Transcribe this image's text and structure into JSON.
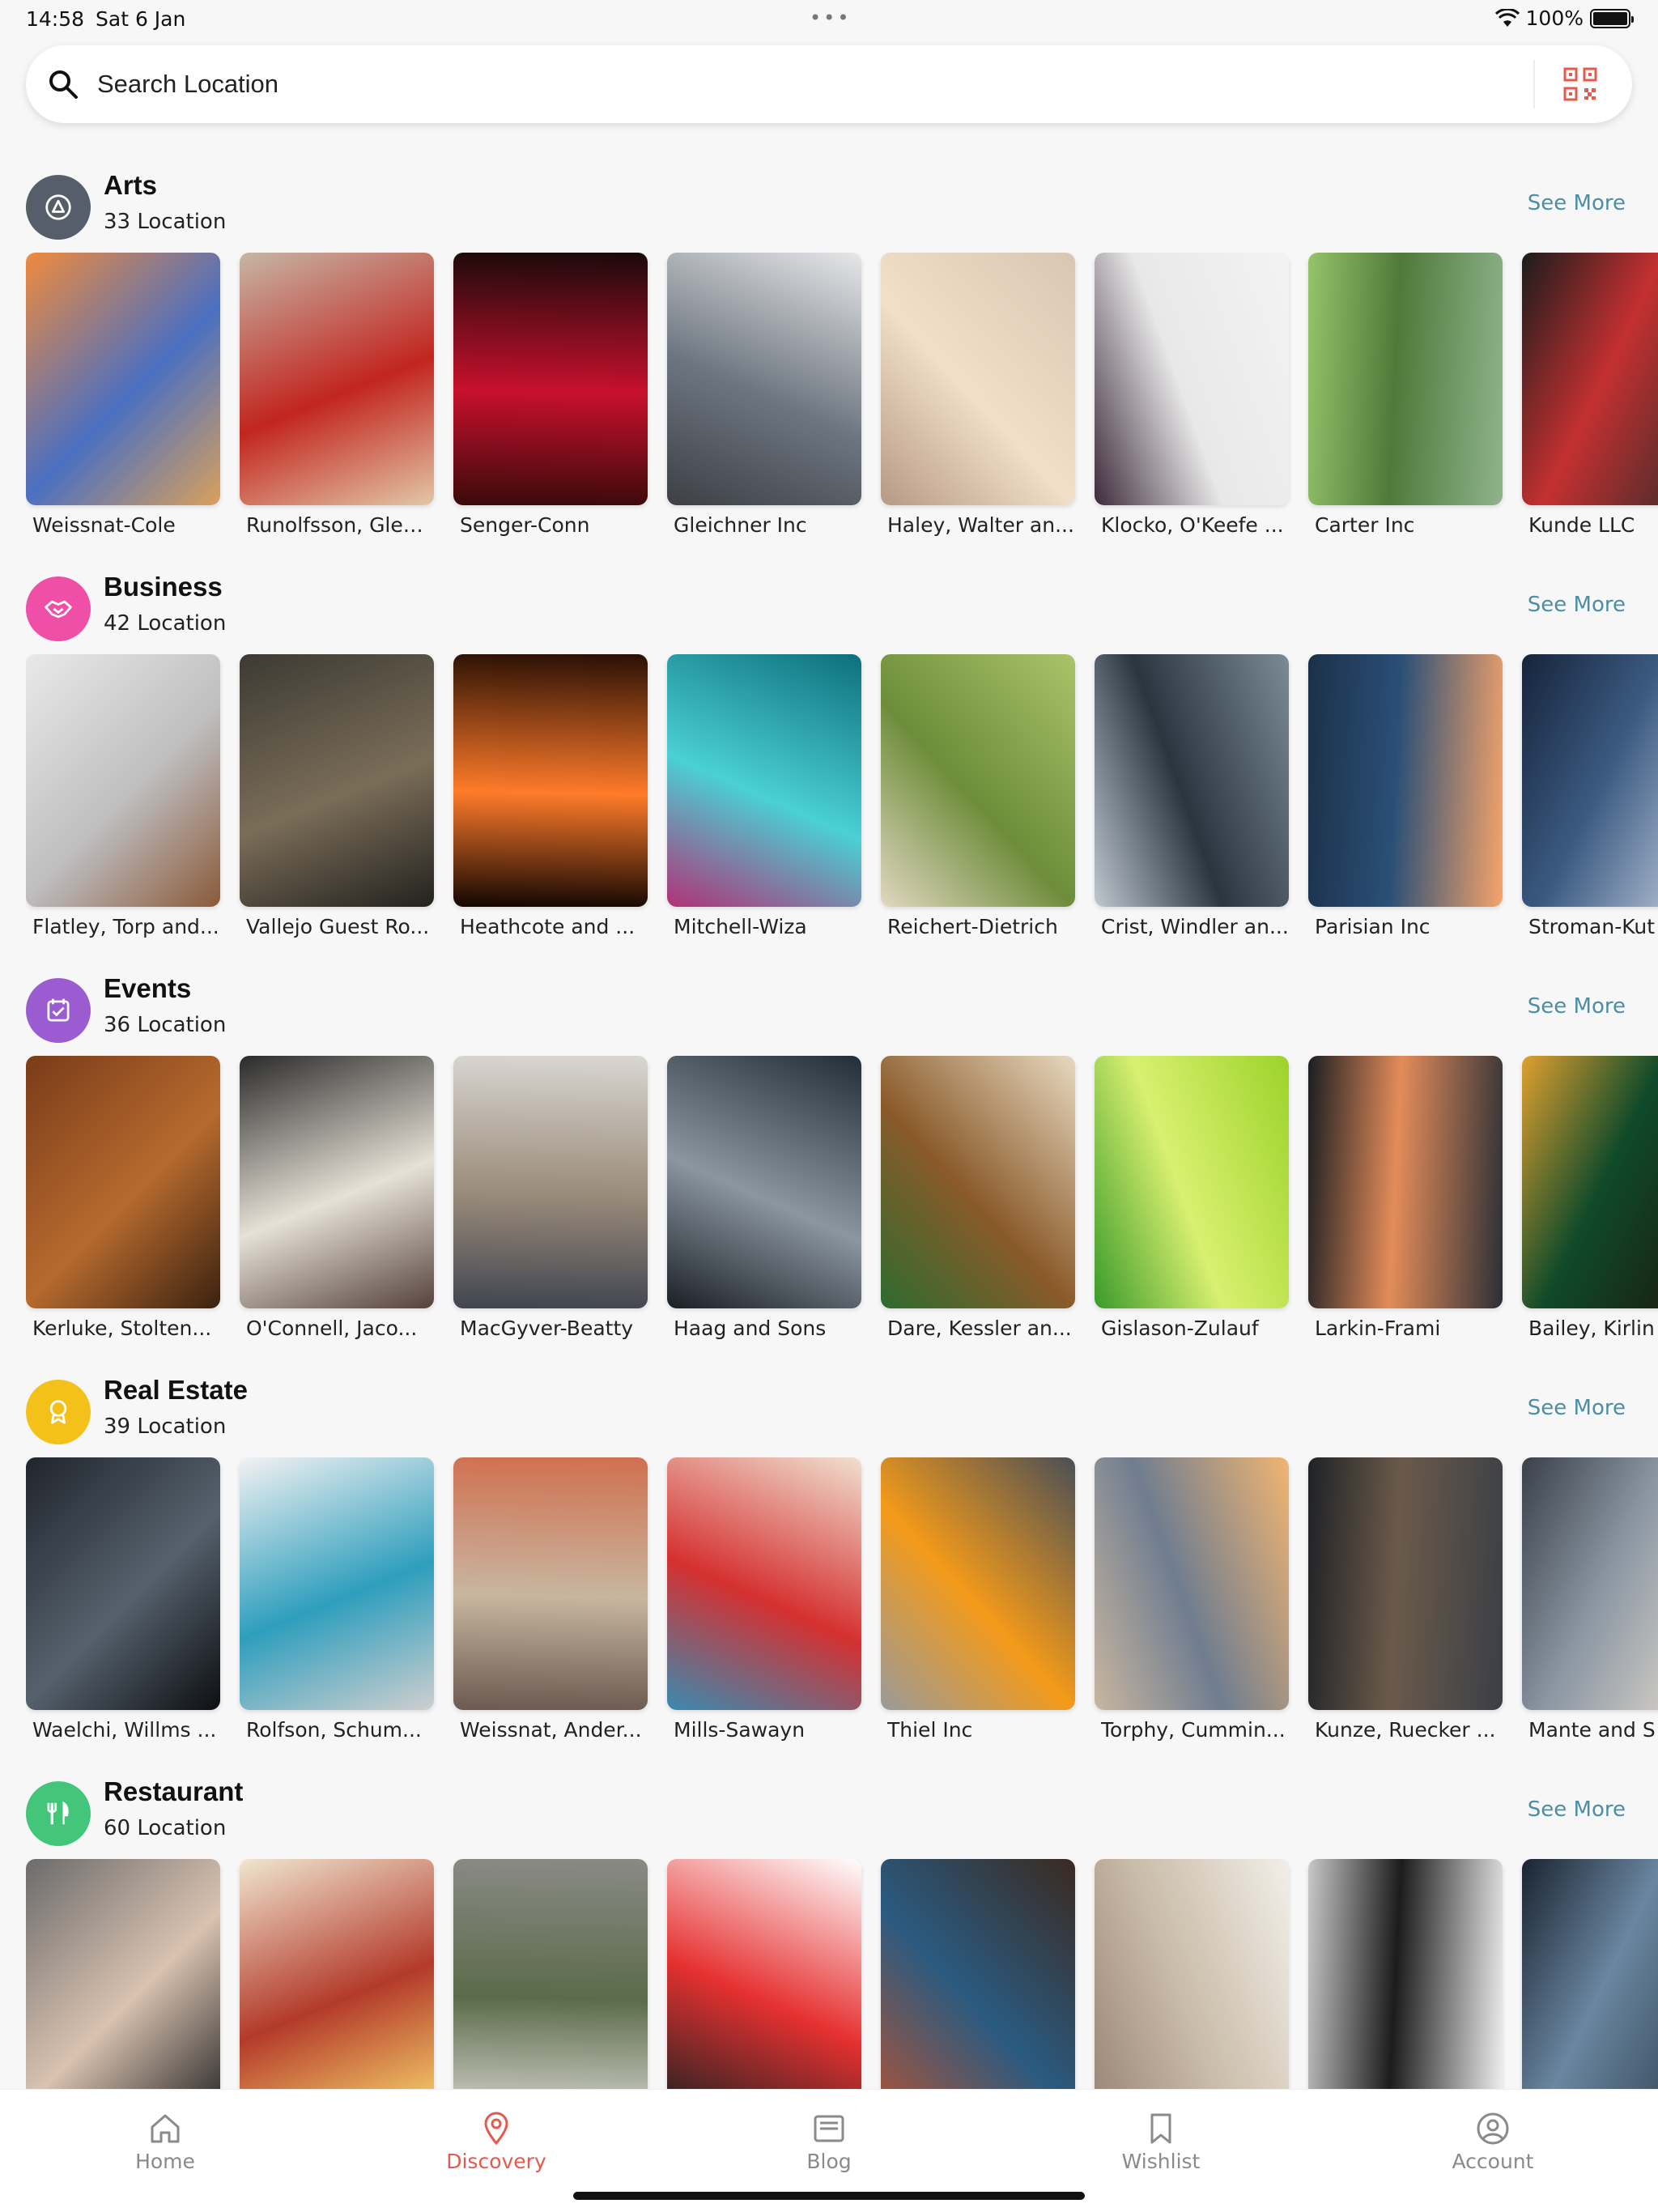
{
  "status_bar": {
    "time": "14:58",
    "date": "Sat 6 Jan",
    "battery": "100%"
  },
  "search": {
    "placeholder": "Search Location"
  },
  "sections": [
    {
      "title": "Arts",
      "count": "33 Location",
      "see_more": "See More",
      "icon": "arts-icon",
      "color": "#555e6a",
      "items": [
        "Weissnat-Cole",
        "Runolfsson, Glea...",
        "Senger-Conn",
        "Gleichner Inc",
        "Haley, Walter an...",
        "Klocko, O'Keefe ...",
        "Carter Inc",
        "Kunde LLC"
      ]
    },
    {
      "title": "Business",
      "count": "42 Location",
      "see_more": "See More",
      "icon": "handshake-icon",
      "color": "#ef4fa6",
      "items": [
        "Flatley, Torp and...",
        "Vallejo Guest Ro...",
        "Heathcote and ...",
        "Mitchell-Wiza",
        "Reichert-Dietrich",
        "Crist, Windler an...",
        "Parisian Inc",
        "Stroman-Kut"
      ]
    },
    {
      "title": "Events",
      "count": "36 Location",
      "see_more": "See More",
      "icon": "calendar-icon",
      "color": "#9b5bd1",
      "items": [
        "Kerluke, Stolten...",
        "O'Connell, Jaco...",
        "MacGyver-Beatty",
        "Haag and Sons",
        "Dare, Kessler an...",
        "Gislason-Zulauf",
        "Larkin-Frami",
        "Bailey, Kirlin"
      ]
    },
    {
      "title": "Real Estate",
      "count": "39 Location",
      "see_more": "See More",
      "icon": "badge-icon",
      "color": "#f4c01a",
      "items": [
        "Waelchi, Willms ...",
        "Rolfson, Schum...",
        "Weissnat, Ander...",
        "Mills-Sawayn",
        "Thiel Inc",
        "Torphy, Cummin...",
        "Kunze, Ruecker ...",
        "Mante and S"
      ]
    },
    {
      "title": "Restaurant",
      "count": "60 Location",
      "see_more": "See More",
      "icon": "fork-knife-icon",
      "color": "#43c57a",
      "items": [
        "",
        "",
        "",
        "",
        "",
        "",
        "",
        ""
      ]
    }
  ],
  "nav": {
    "home": "Home",
    "discovery": "Discovery",
    "blog": "Blog",
    "wishlist": "Wishlist",
    "account": "Account"
  },
  "colors": {
    "accent": "#e55a4e",
    "link": "#4a8fa6"
  }
}
